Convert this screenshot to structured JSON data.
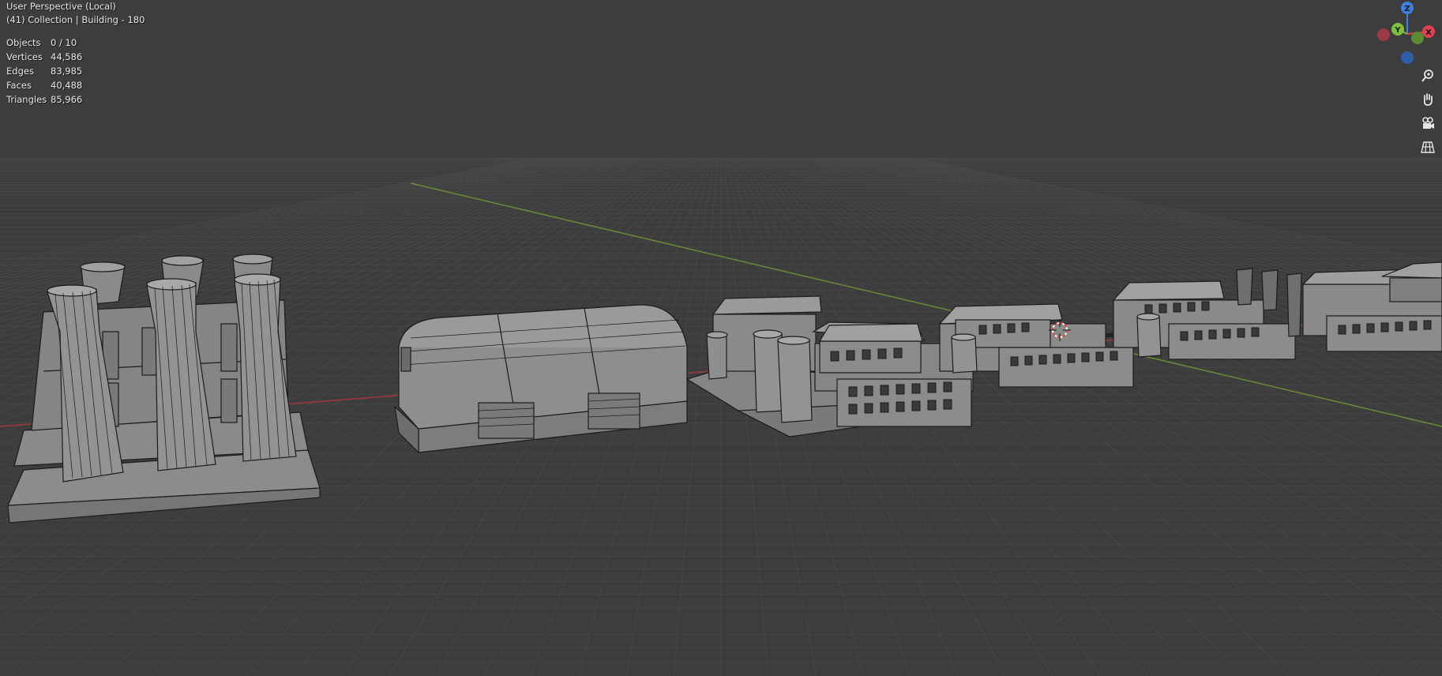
{
  "viewport": {
    "view_name": "User Perspective (Local)",
    "collection_info": "(41) Collection | Building - 180"
  },
  "stats": [
    {
      "label": "Objects",
      "value": "0 / 10"
    },
    {
      "label": "Vertices",
      "value": "44,586"
    },
    {
      "label": "Edges",
      "value": "83,985"
    },
    {
      "label": "Faces",
      "value": "40,488"
    },
    {
      "label": "Triangles",
      "value": "85,966"
    }
  ],
  "gizmo": {
    "x_label": "X",
    "y_label": "Y",
    "z_label": "Z",
    "x_color": "#e0414f",
    "y_color": "#7fbf3c",
    "z_color": "#3f7fe0"
  },
  "nav_tools": [
    "zoom-icon",
    "hand-pan-icon",
    "camera-view-icon",
    "grid-ortho-icon"
  ],
  "colors": {
    "background": "#3d3d3d",
    "grid": "#4a4a4a",
    "x_axis": "#a03a3a",
    "y_axis": "#6a8a35",
    "model_fill": "#8f8f8f",
    "model_wire": "#1c1c1c"
  }
}
